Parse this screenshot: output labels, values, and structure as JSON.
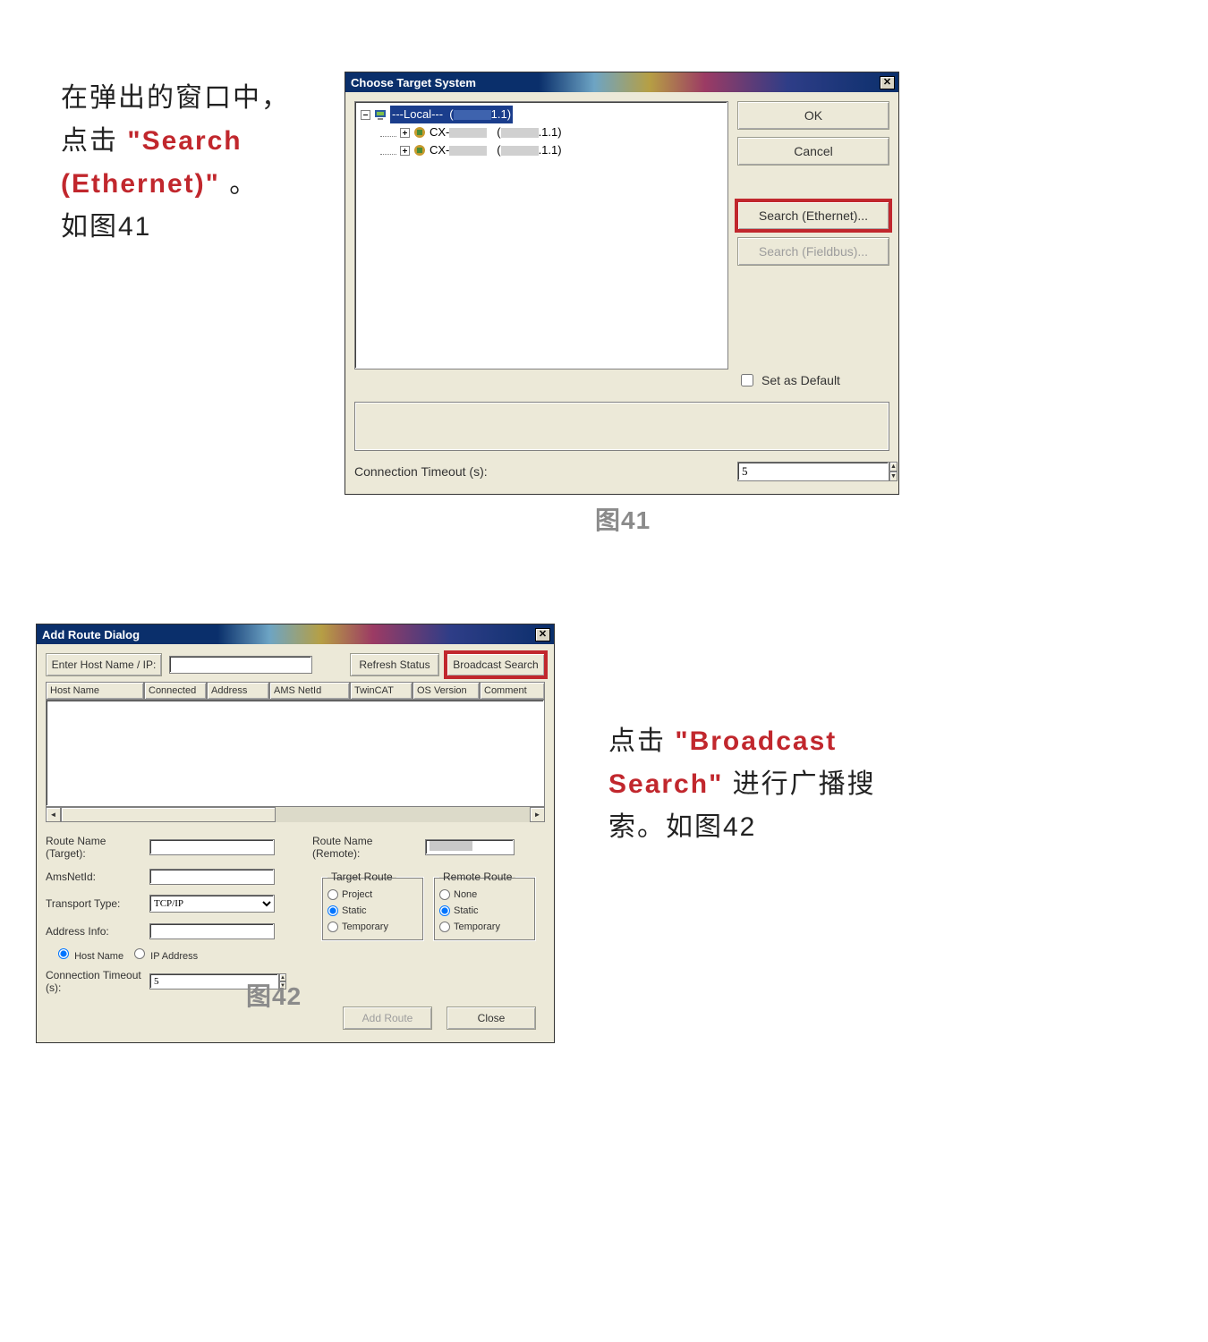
{
  "instruction41": {
    "line1": "在弹出的窗口中，",
    "line2a": "点击 ",
    "line2b_red": "\"Search (Ethernet)\"",
    "line2c": " 。",
    "line3": "如图41"
  },
  "caption41": "图41",
  "instruction42": {
    "line1a": "点击 ",
    "line1b_red": "\"Broadcast Search\"",
    "line1c": " 进行广播搜索。如图42"
  },
  "caption42": "图42",
  "dlg41": {
    "title": "Choose Target System",
    "tree": {
      "root": {
        "label": "---Local---",
        "suffix": "1.1)"
      },
      "children": [
        {
          "label": "CX-",
          "suffix": ".1.1)"
        },
        {
          "label": "CX-",
          "suffix": ".1.1)"
        }
      ]
    },
    "buttons": {
      "ok": "OK",
      "cancel": "Cancel",
      "search_ethernet": "Search (Ethernet)...",
      "search_fieldbus": "Search (Fieldbus)..."
    },
    "set_default_label": "Set as Default",
    "set_default_checked": false,
    "timeout_label": "Connection Timeout (s):",
    "timeout_value": "5"
  },
  "dlg42": {
    "title": "Add Route Dialog",
    "top": {
      "enter_host": "Enter Host Name / IP:",
      "refresh": "Refresh Status",
      "broadcast": "Broadcast Search"
    },
    "columns": [
      "Host Name",
      "Connected",
      "Address",
      "AMS NetId",
      "TwinCAT",
      "OS Version",
      "Comment"
    ],
    "fields": {
      "route_name_target": "Route Name (Target):",
      "amsnetid": "AmsNetId:",
      "transport_type": "Transport Type:",
      "transport_value": "TCP/IP",
      "address_info": "Address Info:",
      "hostname_radio": "Host Name",
      "ipaddress_radio": "IP Address",
      "conn_timeout": "Connection Timeout (s):",
      "conn_timeout_value": "5",
      "route_name_remote": "Route Name (Remote):"
    },
    "target_route": {
      "legend": "Target Route",
      "options": [
        "Project",
        "Static",
        "Temporary"
      ],
      "selected": "Static"
    },
    "remote_route": {
      "legend": "Remote Route",
      "options": [
        "None",
        "Static",
        "Temporary"
      ],
      "selected": "Static"
    },
    "buttons": {
      "add_route": "Add Route",
      "close": "Close"
    }
  }
}
